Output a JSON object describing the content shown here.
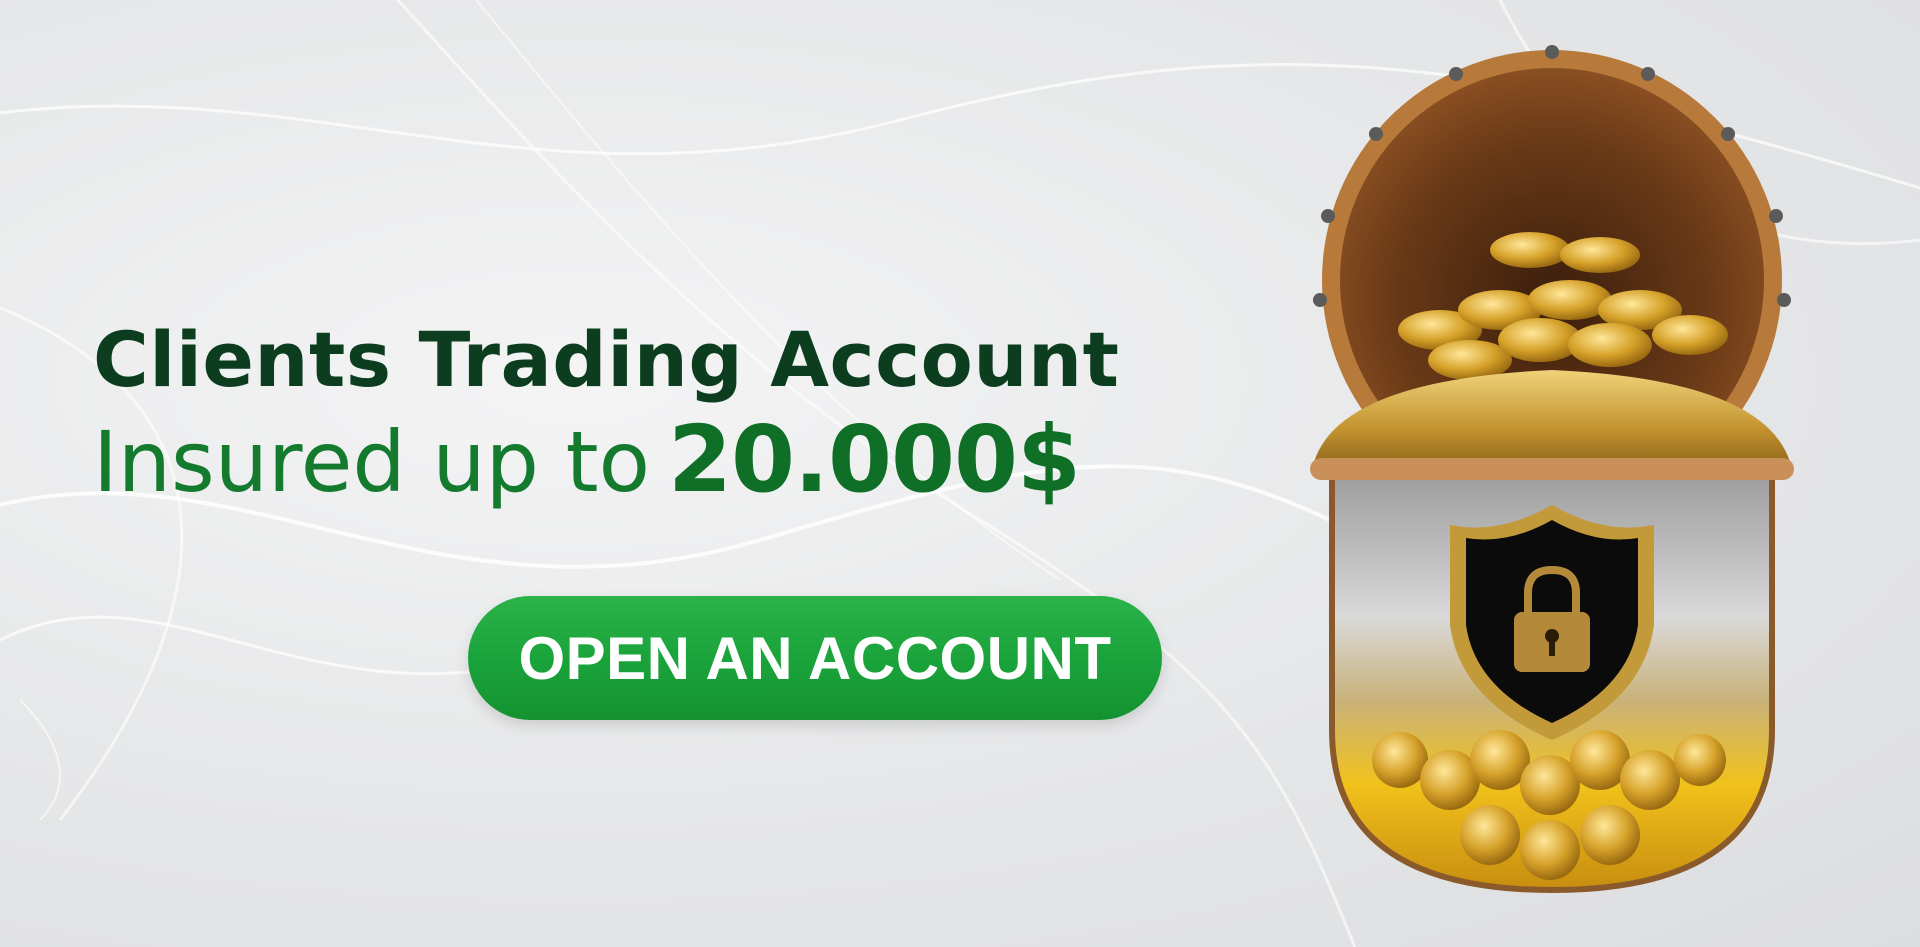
{
  "banner": {
    "headline_line1": "Clients Trading Account",
    "headline_line2_prefix": "Insured up to",
    "headline_amount": "20.000$",
    "cta_label": "OPEN AN ACCOUNT"
  },
  "colors": {
    "headline_dark": "#0b3d1e",
    "headline_green": "#137a2e",
    "cta_green": "#1aa23a",
    "gold": "#d4a32a",
    "background": "#e8e9ea"
  },
  "illustration": {
    "icon": "vault-shield-lock-icon"
  }
}
